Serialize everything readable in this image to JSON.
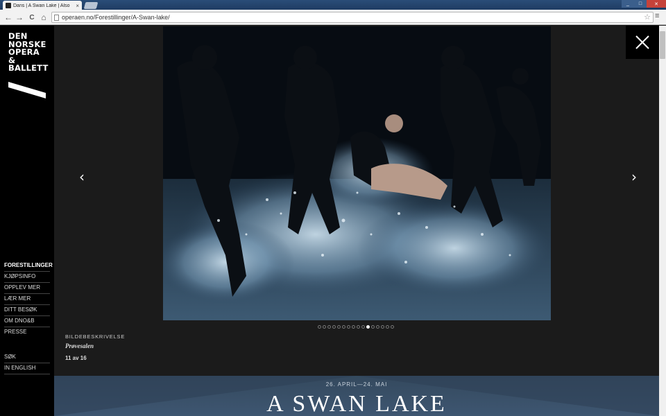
{
  "browser": {
    "tab_title": "Dans | A Swan Lake | Also",
    "tab_close": "×",
    "url": "operaen.no/Forestillinger/A-Swan-lake/",
    "back_glyph": "←",
    "forward_glyph": "→",
    "reload_glyph": "C",
    "home_glyph": "⌂",
    "star_glyph": "☆",
    "menu_glyph": "≡",
    "win_min": "_",
    "win_max": "□",
    "win_close": "✕"
  },
  "logo": {
    "lines": [
      "DEN",
      "NORSKE",
      "OPERA",
      "&",
      "BALLETT"
    ]
  },
  "nav": {
    "items": [
      {
        "label": "Forestillinger"
      },
      {
        "label": "Kjøpsinfo"
      },
      {
        "label": "Opplev mer"
      },
      {
        "label": "Lær mer"
      },
      {
        "label": "Ditt besøk"
      },
      {
        "label": "Om DNO&B"
      },
      {
        "label": "Presse"
      }
    ],
    "secondary": [
      {
        "label": "Søk"
      },
      {
        "label": "In English"
      }
    ]
  },
  "gallery": {
    "prev_glyph": "‹",
    "next_glyph": "›",
    "caption_label": "Bildebeskrivelse",
    "caption_text": "Prøvesalen",
    "counter": "11 av 16",
    "total": 16,
    "current": 11
  },
  "hero": {
    "date": "26. APRIL—24. MAI",
    "title": "A SWAN LAKE"
  },
  "icons": {
    "close": "close-icon",
    "prev": "chevron-left-icon",
    "next": "chevron-right-icon"
  }
}
